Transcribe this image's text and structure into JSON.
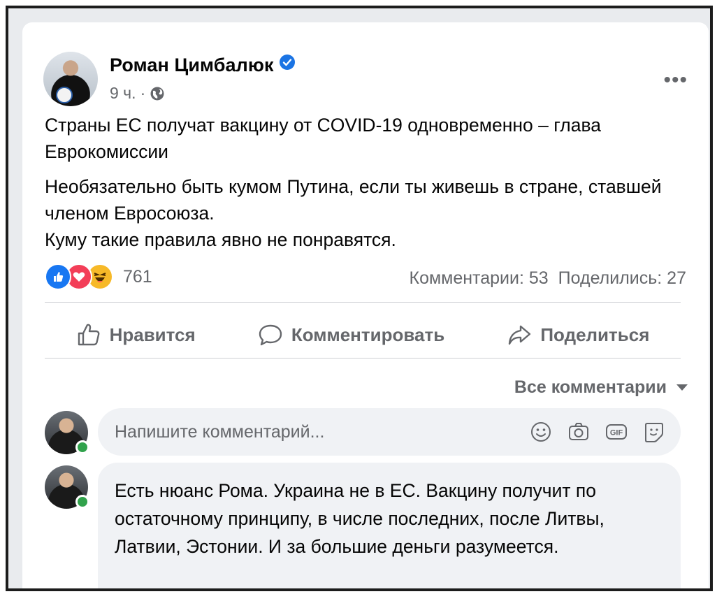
{
  "post": {
    "author": "Роман Цимбалюк",
    "time": "9 ч.",
    "separator": "·",
    "more_label": "•••",
    "headline": "Страны ЕС получат вакцину от COVID-19 одновременно – глава Еврокомиссии",
    "body_line1": "Необязательно быть кумом Путина, если ты живешь в стране, ставшей членом Евросоюза.",
    "body_line2": "Куму такие правила явно не понравятся.",
    "reaction_count": "761",
    "comments_stat": "Комментарии: 53",
    "shares_stat": "Поделились: 27"
  },
  "actions": {
    "like": "Нравится",
    "comment": "Комментировать",
    "share": "Поделиться"
  },
  "comments": {
    "sort_label": "Все комментарии",
    "input_placeholder": "Напишите комментарий...",
    "first_comment_text": "Есть нюанс Рома. Украина не в ЕС. Вакцину получит по остаточному принципу, в числе последних, после Литвы, Латвии, Эстонии. И за большие деньги разумеется."
  },
  "icons": {
    "verified": "verified-badge-icon",
    "privacy": "globe-icon",
    "reactions": [
      "like-reaction-icon",
      "love-reaction-icon",
      "haha-reaction-icon"
    ],
    "input": [
      "emoji-icon",
      "camera-icon",
      "gif-icon",
      "sticker-icon"
    ]
  },
  "colors": {
    "brand_blue": "#1877f2",
    "secondary_text": "#65676b",
    "input_bg": "#f0f2f5",
    "online": "#31a24c"
  }
}
